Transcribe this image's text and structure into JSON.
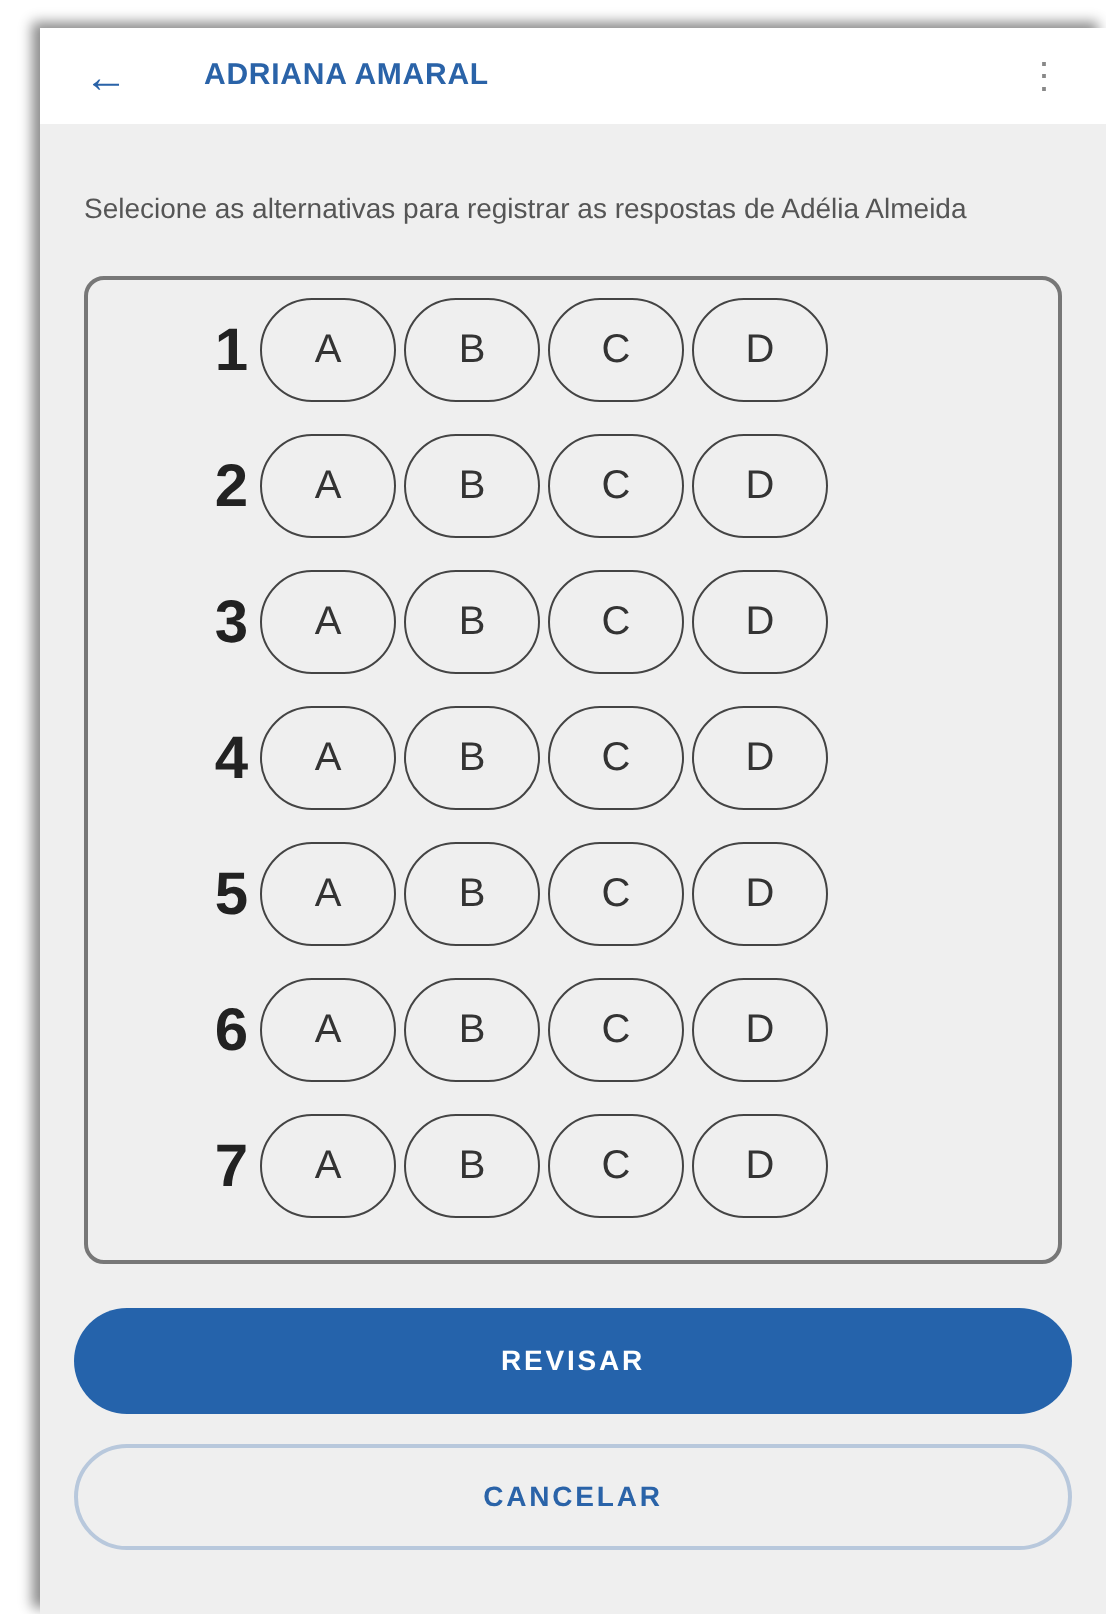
{
  "header": {
    "back": "←",
    "title": "ADRIANA AMARAL",
    "menu": "⋮"
  },
  "instructions": "Selecione as alternativas para registrar as respostas de Adélia Almeida",
  "questions": [
    {
      "number": "1",
      "options": [
        {
          "label": "A",
          "selected": false
        },
        {
          "label": "B",
          "selected": false
        },
        {
          "label": "C",
          "selected": false
        },
        {
          "label": "D",
          "selected": false
        }
      ]
    },
    {
      "number": "2",
      "options": [
        {
          "label": "A",
          "selected": false
        },
        {
          "label": "B",
          "selected": false
        },
        {
          "label": "C",
          "selected": false
        },
        {
          "label": "D",
          "selected": false
        }
      ]
    },
    {
      "number": "3",
      "options": [
        {
          "label": "A",
          "selected": false
        },
        {
          "label": "B",
          "selected": false
        },
        {
          "label": "C",
          "selected": false
        },
        {
          "label": "D",
          "selected": false
        }
      ]
    },
    {
      "number": "4",
      "options": [
        {
          "label": "A",
          "selected": false
        },
        {
          "label": "B",
          "selected": false
        },
        {
          "label": "C",
          "selected": false
        },
        {
          "label": "D",
          "selected": false
        }
      ]
    },
    {
      "number": "5",
      "options": [
        {
          "label": "A",
          "selected": false
        },
        {
          "label": "B",
          "selected": false
        },
        {
          "label": "C",
          "selected": false
        },
        {
          "label": "D",
          "selected": false
        }
      ]
    },
    {
      "number": "6",
      "options": [
        {
          "label": "A",
          "selected": false
        },
        {
          "label": "B",
          "selected": false
        },
        {
          "label": "C",
          "selected": false
        },
        {
          "label": "D",
          "selected": false
        }
      ]
    },
    {
      "number": "7",
      "options": [
        {
          "label": "A",
          "selected": false
        },
        {
          "label": "B",
          "selected": false
        },
        {
          "label": "C",
          "selected": false
        },
        {
          "label": "D",
          "selected": false
        }
      ]
    }
  ],
  "buttons": [
    {
      "kind": "primary",
      "label": "REVISAR"
    },
    {
      "kind": "secondary",
      "label": "CANCELAR"
    }
  ]
}
